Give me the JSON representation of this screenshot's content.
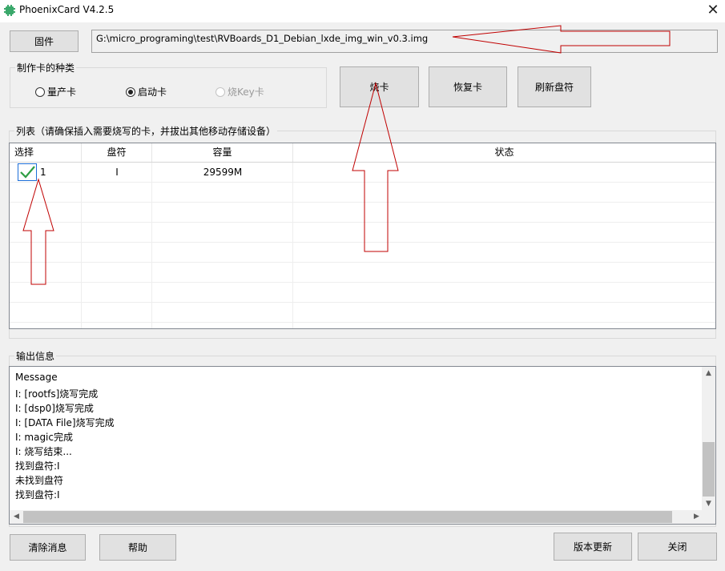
{
  "window": {
    "title": "PhoenixCard V4.2.5"
  },
  "firmware": {
    "button_label": "固件",
    "path": "G:\\micro_programing\\test\\RVBoards_D1_Debian_lxde_img_win_v0.3.img"
  },
  "card_type": {
    "title": "制作卡的种类",
    "options": [
      {
        "label": "量产卡",
        "selected": false,
        "enabled": true
      },
      {
        "label": "启动卡",
        "selected": true,
        "enabled": true
      },
      {
        "label": "烧Key卡",
        "selected": false,
        "enabled": false
      }
    ]
  },
  "actions": {
    "burn": "烧卡",
    "restore": "恢复卡",
    "refresh": "刷新盘符"
  },
  "list": {
    "title": "列表（请确保插入需要烧写的卡，并拔出其他移动存储设备）",
    "columns": [
      "选择",
      "盘符",
      "容量",
      "状态"
    ],
    "rows": [
      {
        "checked": true,
        "index": "1",
        "drive": "I",
        "capacity": "29599M",
        "status": ""
      }
    ]
  },
  "output": {
    "title": "输出信息",
    "lines": [
      "Message",
      "I: [rootfs]烧写完成",
      "I: [dsp0]烧写完成",
      "I: [DATA File]烧写完成",
      "I: magic完成",
      "I: 烧写结束...",
      "找到盘符:I",
      "未找到盘符",
      "找到盘符:I"
    ]
  },
  "footer": {
    "clear": "清除消息",
    "help": "帮助",
    "update": "版本更新",
    "close": "关闭"
  },
  "colors": {
    "annotation_arrow": "#c00000",
    "check": "#2f9e44",
    "focus": "#1e6fd9"
  },
  "icons": {
    "app": "green-chip-icon",
    "close": "close-icon",
    "check": "check-icon"
  }
}
